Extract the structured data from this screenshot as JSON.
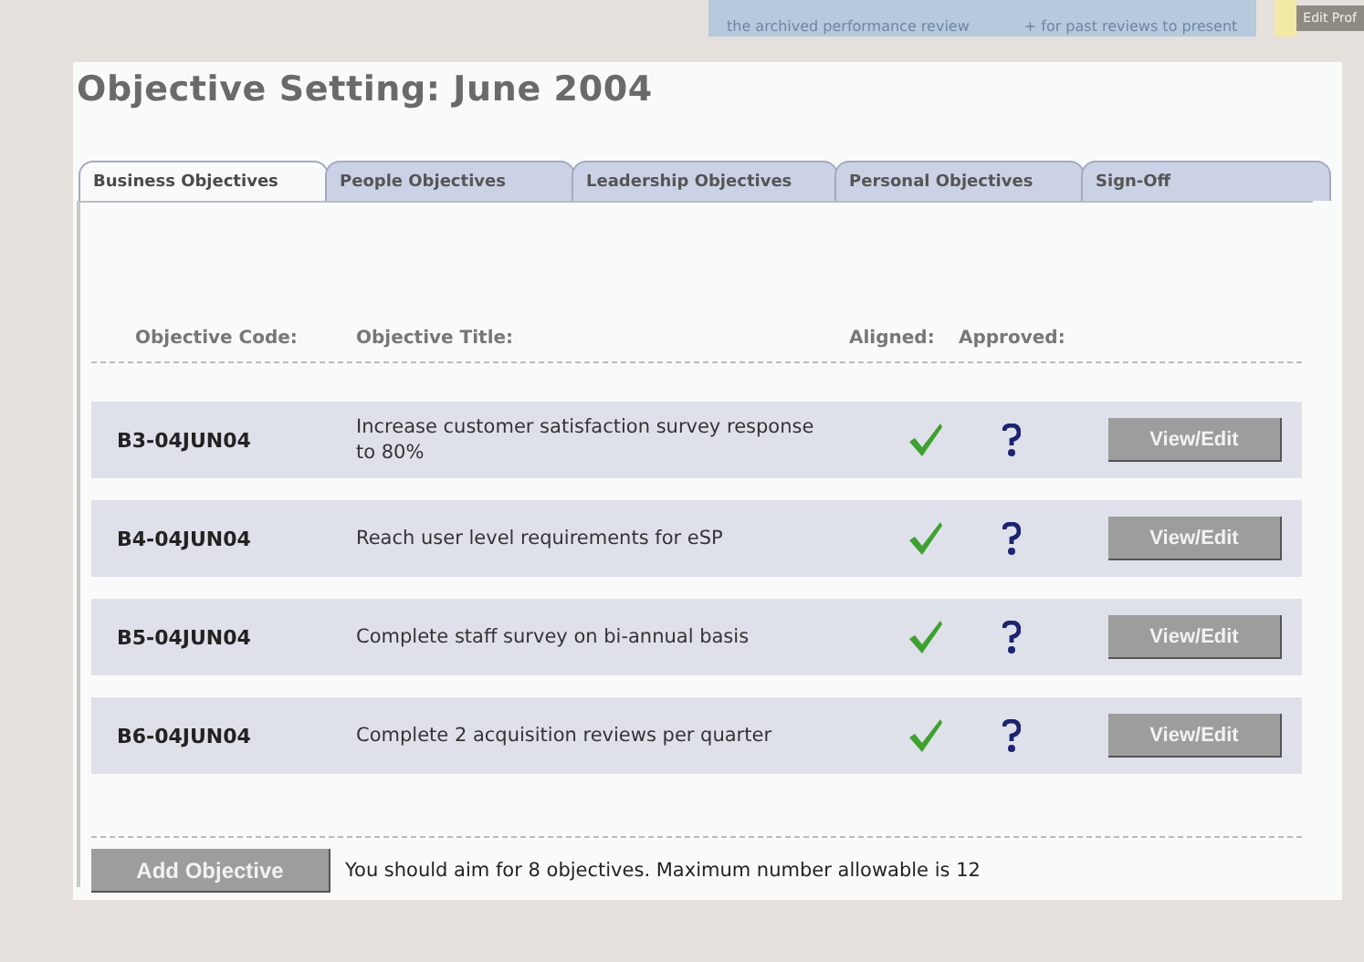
{
  "top_panel": {
    "text_1": "the archived performance review",
    "text_2": "+ for past reviews to present",
    "button": "Edit Prof"
  },
  "title": "Objective Setting: June 2004",
  "tabs": [
    {
      "label": "Business Objectives",
      "selected": true
    },
    {
      "label": "People Objectives",
      "selected": false
    },
    {
      "label": "Leadership Objectives",
      "selected": false
    },
    {
      "label": "Personal Objectives",
      "selected": false
    },
    {
      "label": "Sign-Off",
      "selected": false
    }
  ],
  "columns": [
    "Objective Code:",
    "Objective Title:",
    "Aligned:",
    "Approved:"
  ],
  "rows": [
    {
      "code": "B3-04JUN04",
      "title": "Increase customer satisfaction survey response to 80%",
      "aligned": true,
      "approved": false,
      "button": "View/Edit"
    },
    {
      "code": "B4-04JUN04",
      "title": "Reach user level requirements for eSP",
      "aligned": true,
      "approved": false,
      "button": "View/Edit"
    },
    {
      "code": "B5-04JUN04",
      "title": "Complete staff survey on bi-annual basis",
      "aligned": true,
      "approved": false,
      "button": "View/Edit"
    },
    {
      "code": "B6-04JUN04",
      "title": "Complete 2 acquisition reviews per quarter",
      "aligned": true,
      "approved": false,
      "button": "View/Edit"
    }
  ],
  "add_button": "Add Objective",
  "note": "You should aim for 8 objectives. Maximum number allowable is 12"
}
